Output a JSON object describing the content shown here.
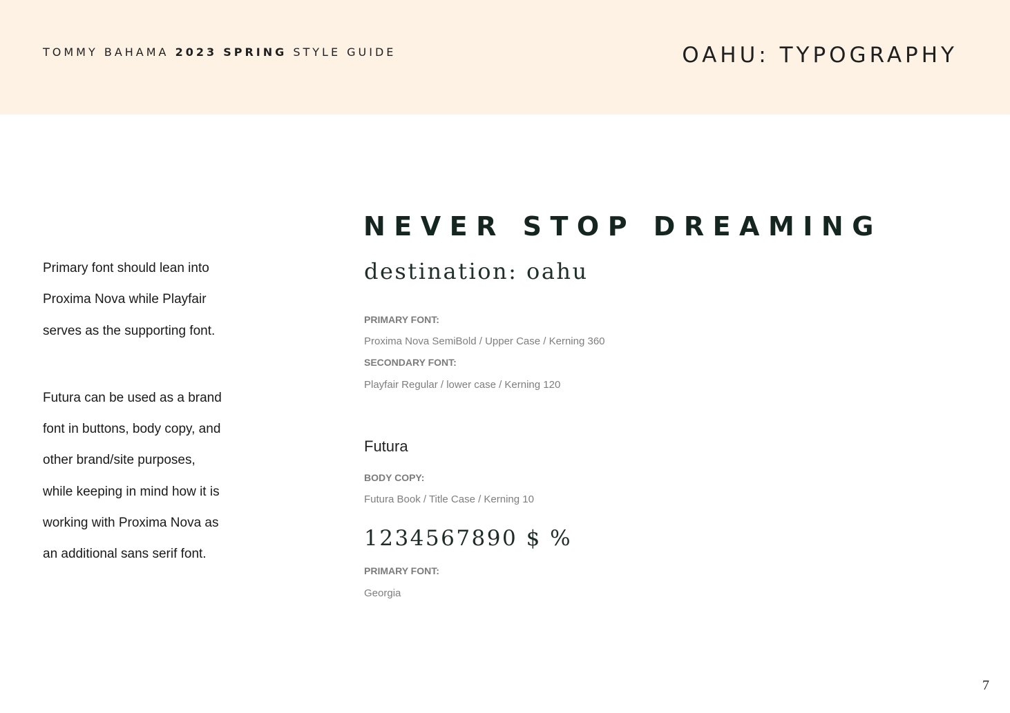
{
  "header": {
    "brand_prefix": "TOMMY BAHAMA",
    "brand_year": "2023",
    "brand_season": "SPRING",
    "brand_suffix": "STYLE GUIDE",
    "page_title": "OAHU: TYPOGRAPHY",
    "background_color": "#fdf2e4"
  },
  "intro": {
    "lines_1": [
      "Primary font should lean into",
      "Proxima Nova while Playfair",
      "serves as the supporting font."
    ],
    "lines_2": [
      "Futura can be used as a brand",
      "font in buttons, body copy,  and",
      "other brand/site purposes,",
      "while keeping in mind how it is",
      "working with Proxima Nova as",
      "an additional sans serif font."
    ]
  },
  "samples": {
    "headline": "NEVER STOP DREAMING",
    "subhead": "destination: oahu",
    "primary_label": "PRIMARY FONT:",
    "primary_spec": "Proxima Nova  SemiBold / Upper Case / Kerning 360",
    "secondary_label": "SECONDARY FONT:",
    "secondary_spec": "Playfair Regular  / lower case / Kerning 120",
    "futura_sample": "Futura",
    "body_label": "BODY COPY:",
    "body_spec": "Futura Book / Title Case / Kerning 10",
    "numerals_sample": "1234567890 $ %",
    "numerals_label": "PRIMARY FONT:",
    "numerals_spec": "Georgia",
    "headline_color": "#14261f"
  },
  "footer": {
    "page_number": "7"
  }
}
